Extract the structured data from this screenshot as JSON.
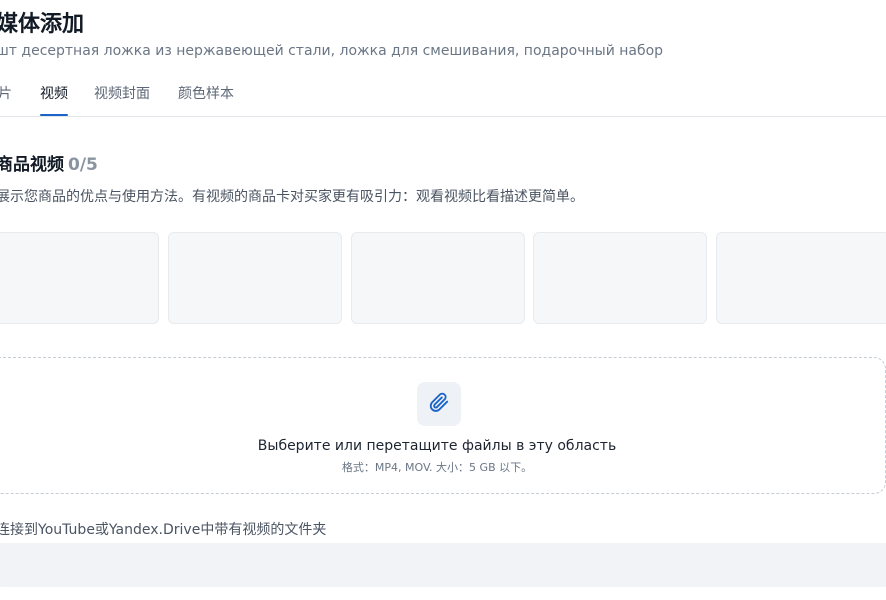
{
  "header": {
    "title": "媒体添加",
    "subtitle": "шт десертная ложка из нержавеющей стали, ложка для смешивания, подарочный набор"
  },
  "tabs": [
    {
      "label": "片",
      "active": false
    },
    {
      "label": "视频",
      "active": true
    },
    {
      "label": "视频封面",
      "active": false
    },
    {
      "label": "颜色样本",
      "active": false
    }
  ],
  "video_section": {
    "title": "商品视频",
    "count": "0/5",
    "description": "展示您商品的优点与使用方法。有视频的商品卡对买家更有吸引力：观看视频比看描述更简单。"
  },
  "dropzone": {
    "icon": "paperclip-icon",
    "main_text": "Выберите или перетащите файлы в эту область",
    "hint": "格式：MP4, MOV. 大小：5 GB 以下。"
  },
  "link": {
    "label": "连接到YouTube或Yandex.Drive中带有视频的文件夹",
    "value": "",
    "placeholder": ""
  },
  "colors": {
    "accent": "#1a64c9",
    "slot_background": "#f6f7f9",
    "input_background": "#f1f3f6"
  }
}
